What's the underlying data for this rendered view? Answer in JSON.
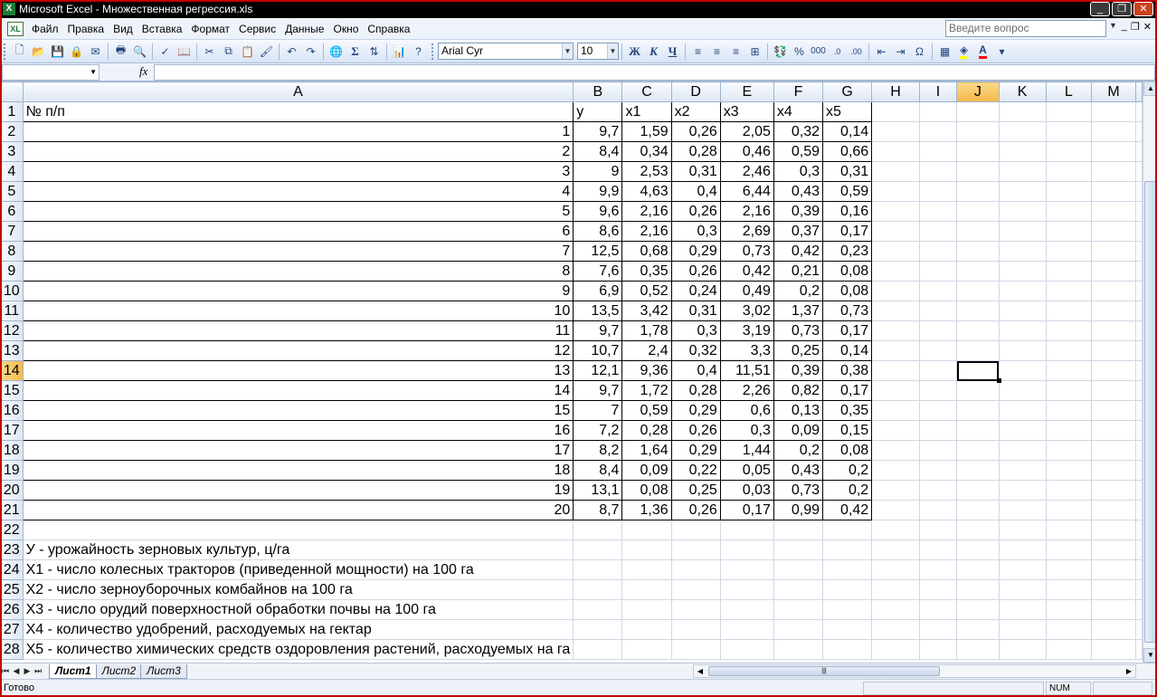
{
  "window": {
    "title": "Microsoft Excel - Множественная регрессия.xls",
    "app_icon": "excel-icon",
    "ask_placeholder": "Введите вопрос"
  },
  "menu": {
    "items": [
      "Файл",
      "Правка",
      "Вид",
      "Вставка",
      "Формат",
      "Сервис",
      "Данные",
      "Окно",
      "Справка"
    ]
  },
  "toolbar": {
    "font_name": "Arial Cyr",
    "font_size": "10",
    "bold": "Ж",
    "italic": "К",
    "underline": "Ч",
    "percent": "%",
    "thousands": "000",
    "sigma": "Σ",
    "omega": "Ω",
    "fill_color": "#ffff00",
    "font_color": "#ff0000"
  },
  "formula_bar": {
    "name_box": "",
    "fx_label": "fx",
    "formula": ""
  },
  "sheet": {
    "columns": [
      "A",
      "B",
      "C",
      "D",
      "E",
      "F",
      "G",
      "H",
      "I",
      "J",
      "K",
      "L",
      "M"
    ],
    "selected_column": "J",
    "selected_row": 14,
    "active_cell": "J14",
    "header": [
      "№ п/п",
      "y",
      "x1",
      "x2",
      "x3",
      "x4",
      "x5"
    ],
    "rows": [
      [
        "1",
        "9,7",
        "1,59",
        "0,26",
        "2,05",
        "0,32",
        "0,14"
      ],
      [
        "2",
        "8,4",
        "0,34",
        "0,28",
        "0,46",
        "0,59",
        "0,66"
      ],
      [
        "3",
        "9",
        "2,53",
        "0,31",
        "2,46",
        "0,3",
        "0,31"
      ],
      [
        "4",
        "9,9",
        "4,63",
        "0,4",
        "6,44",
        "0,43",
        "0,59"
      ],
      [
        "5",
        "9,6",
        "2,16",
        "0,26",
        "2,16",
        "0,39",
        "0,16"
      ],
      [
        "6",
        "8,6",
        "2,16",
        "0,3",
        "2,69",
        "0,37",
        "0,17"
      ],
      [
        "7",
        "12,5",
        "0,68",
        "0,29",
        "0,73",
        "0,42",
        "0,23"
      ],
      [
        "8",
        "7,6",
        "0,35",
        "0,26",
        "0,42",
        "0,21",
        "0,08"
      ],
      [
        "9",
        "6,9",
        "0,52",
        "0,24",
        "0,49",
        "0,2",
        "0,08"
      ],
      [
        "10",
        "13,5",
        "3,42",
        "0,31",
        "3,02",
        "1,37",
        "0,73"
      ],
      [
        "11",
        "9,7",
        "1,78",
        "0,3",
        "3,19",
        "0,73",
        "0,17"
      ],
      [
        "12",
        "10,7",
        "2,4",
        "0,32",
        "3,3",
        "0,25",
        "0,14"
      ],
      [
        "13",
        "12,1",
        "9,36",
        "0,4",
        "11,51",
        "0,39",
        "0,38"
      ],
      [
        "14",
        "9,7",
        "1,72",
        "0,28",
        "2,26",
        "0,82",
        "0,17"
      ],
      [
        "15",
        "7",
        "0,59",
        "0,29",
        "0,6",
        "0,13",
        "0,35"
      ],
      [
        "16",
        "7,2",
        "0,28",
        "0,26",
        "0,3",
        "0,09",
        "0,15"
      ],
      [
        "17",
        "8,2",
        "1,64",
        "0,29",
        "1,44",
        "0,2",
        "0,08"
      ],
      [
        "18",
        "8,4",
        "0,09",
        "0,22",
        "0,05",
        "0,43",
        "0,2"
      ],
      [
        "19",
        "13,1",
        "0,08",
        "0,25",
        "0,03",
        "0,73",
        "0,2"
      ],
      [
        "20",
        "8,7",
        "1,36",
        "0,26",
        "0,17",
        "0,99",
        "0,42"
      ]
    ],
    "notes": [
      "У - урожайность зерновых культур, ц/га",
      "Х1 - число колесных тракторов (приведенной мощности) на 100 га",
      "Х2 - число зерноуборочных комбайнов на 100 га",
      "Х3 - число орудий поверхностной обработки почвы на 100 га",
      "Х4 - количество удобрений, расходуемых на гектар",
      "Х5 - количество химических средств оздоровления растений, расходуемых на га"
    ]
  },
  "tabs": [
    "Лист1",
    "Лист2",
    "Лист3"
  ],
  "active_tab": "Лист1",
  "status": {
    "ready": "Готово",
    "num": "NUM"
  }
}
